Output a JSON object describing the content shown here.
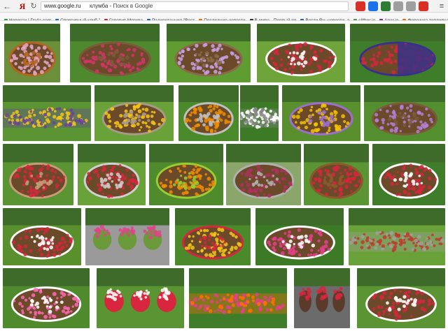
{
  "toolbar": {
    "back_icon": "arrow-left-icon",
    "home_icon": "yandex-logo-icon",
    "home_glyph": "Я",
    "reload_icon": "reload-icon",
    "address_host": "www.google.ru",
    "address_query": "клумба",
    "address_title": "Поиск в Google",
    "extensions": [
      {
        "name": "ext-1",
        "color": "#d93025"
      },
      {
        "name": "ext-2",
        "color": "#1a73e8"
      },
      {
        "name": "ext-3",
        "color": "#2e7d32"
      },
      {
        "name": "ext-4",
        "color": "#9e9e9e"
      },
      {
        "name": "ext-5",
        "color": "#9e9e9e"
      },
      {
        "name": "ext-6",
        "color": "#d93025"
      }
    ],
    "menu_icon": "menu-icon"
  },
  "bookmarks": [
    {
      "label": "Новости | Do4a.com",
      "color": "#2a9d2a"
    },
    {
      "label": "Спортивный клуб \"",
      "color": "#1565c0"
    },
    {
      "label": "Говорит Москва",
      "color": "#c62828"
    },
    {
      "label": "Радиостанция \"Вест",
      "color": "#1565c0"
    },
    {
      "label": "Последние новости",
      "color": "#ef6c00"
    },
    {
      "label": "В мире - Первый по",
      "color": "#333333"
    },
    {
      "label": "Вести.Ru: новости, а",
      "color": "#1565c0"
    },
    {
      "label": "slither.io",
      "color": "#43a047"
    },
    {
      "label": "Agar.io",
      "color": "#8e24aa"
    },
    {
      "label": "Форсунка топливна",
      "color": "#ef6c00"
    }
  ],
  "results": {
    "image_count": 29,
    "thumbnails": [
      {
        "name": "wheelbarrow-flowerbed"
      },
      {
        "name": "round-bed-under-tree"
      },
      {
        "name": "bed-with-pot"
      },
      {
        "name": "bed-with-red-flowers"
      },
      {
        "name": "ladybug-bed"
      },
      {
        "name": "long-border-bed"
      },
      {
        "name": "stone-bed"
      },
      {
        "name": "spilled-pot-bed"
      },
      {
        "name": "spilled-flower-stream"
      },
      {
        "name": "yellow-car-planter"
      },
      {
        "name": "log-planter"
      },
      {
        "name": "path-circle-bed"
      },
      {
        "name": "silver-red-circle"
      },
      {
        "name": "mounded-grass-bed"
      },
      {
        "name": "patterned-circle-bed"
      },
      {
        "name": "wooden-crate-planter"
      },
      {
        "name": "tire-planter"
      },
      {
        "name": "white-bench-planter"
      },
      {
        "name": "tire-collage"
      },
      {
        "name": "butterfly-bed"
      },
      {
        "name": "mixed-petunias"
      },
      {
        "name": "park-border"
      },
      {
        "name": "round-grass-bed"
      },
      {
        "name": "toilet-planters"
      },
      {
        "name": "bright-park-field"
      },
      {
        "name": "stepped-box-planter"
      },
      {
        "name": "heart-shaped-bed"
      }
    ]
  }
}
